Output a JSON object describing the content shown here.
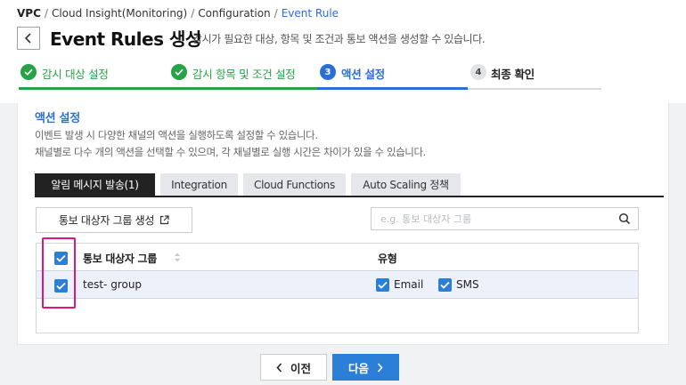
{
  "breadcrumb": {
    "items": [
      "VPC",
      "Cloud Insight(Monitoring)",
      "Configuration"
    ],
    "current": "Event Rule"
  },
  "header": {
    "title": "Event Rules 생성",
    "description": "감시가 필요한 대상, 항목 및 조건과 통보 액션을 생성할 수 있습니다."
  },
  "steps": [
    {
      "label": "감시 대상 설정",
      "status": "done"
    },
    {
      "label": "감시 항목 및 조건 설정",
      "status": "done"
    },
    {
      "label": "액션 설정",
      "status": "active",
      "number": "3"
    },
    {
      "label": "최종 확인",
      "status": "pending",
      "number": "4"
    }
  ],
  "section": {
    "title": "액션 설정",
    "desc_line1": "이벤트 발생 시 다양한 채널의 액션을 실행하도록 설정할 수 있습니다.",
    "desc_line2": "채널별로 다수 개의 액션을 선택할 수 있으며, 각 채널별로 실행 시간은 차이가 있을 수 있습니다."
  },
  "tabs": [
    {
      "label": "알림 메시지 발송(1)",
      "active": true
    },
    {
      "label": "Integration",
      "active": false
    },
    {
      "label": "Cloud Functions",
      "active": false
    },
    {
      "label": "Auto Scaling 정책",
      "active": false
    }
  ],
  "toolbar": {
    "create_label": "통보 대상자 그룹 생성",
    "search_placeholder": "e.g. 통보 대상자 그룹"
  },
  "table": {
    "col_group": "통보 대상자 그룹",
    "col_type": "유형",
    "header_checked": true,
    "rows": [
      {
        "group": "test- group",
        "checked": true,
        "email_label": "Email",
        "email_checked": true,
        "sms_label": "SMS",
        "sms_checked": true
      }
    ]
  },
  "footer": {
    "prev_label": "이전",
    "next_label": "다음"
  },
  "colors": {
    "accent": "#2b7fd6",
    "done": "#27a347",
    "highlight": "#e0177a"
  }
}
